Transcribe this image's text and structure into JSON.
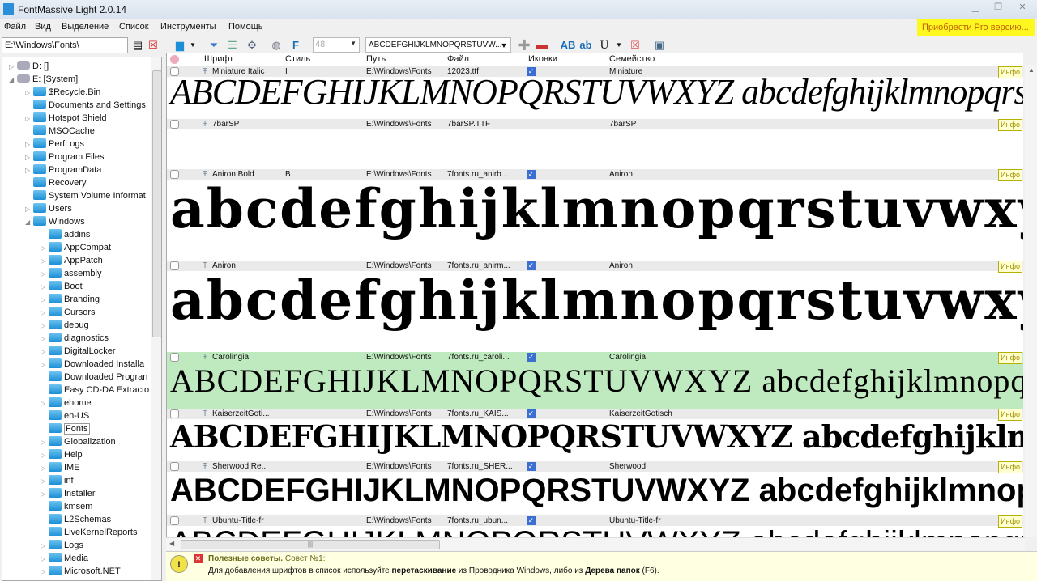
{
  "window": {
    "title": "FontMassive Light 2.0.14"
  },
  "menu": [
    "Файл",
    "Вид",
    "Выделение",
    "Список",
    "Инструменты",
    "Помощь"
  ],
  "pro_button": "Приобрести Pro версию...",
  "path": "E:\\Windows\\Fonts\\",
  "toolbar": {
    "size": "48",
    "sample": "ABCDEFGHIJKLMNOPQRSTUVW...",
    "bold_upper": "AB",
    "bold_lower": "ab",
    "underline": "U"
  },
  "sample_text": "ABCDEFGHIJKLMNOPQRSTUVWXYZ abcdefghijklmnopqrstuvwxyz",
  "columns": {
    "font": "Шрифт",
    "style": "Стиль",
    "path": "Путь",
    "file": "Файл",
    "icons": "Иконки",
    "family": "Семейство"
  },
  "info_label": "Инфо",
  "fonts": [
    {
      "name": "Miniature Italic",
      "style": "I",
      "path": "E:\\Windows\\Fonts",
      "file": "12023.ttf",
      "icons": true,
      "family": "Miniature"
    },
    {
      "name": "7barSP",
      "style": "",
      "path": "E:\\Windows\\Fonts",
      "file": "7barSP.TTF",
      "icons": false,
      "family": "7barSP"
    },
    {
      "name": "Aniron Bold",
      "style": "B",
      "path": "E:\\Windows\\Fonts",
      "file": "7fonts.ru_anirb...",
      "icons": true,
      "family": "Aniron"
    },
    {
      "name": "Aniron",
      "style": "",
      "path": "E:\\Windows\\Fonts",
      "file": "7fonts.ru_anirm...",
      "icons": true,
      "family": "Aniron"
    },
    {
      "name": "Carolingia",
      "style": "",
      "path": "E:\\Windows\\Fonts",
      "file": "7fonts.ru_caroli...",
      "icons": true,
      "family": "Carolingia",
      "highlighted": true
    },
    {
      "name": "KaiserzeitGoti...",
      "style": "",
      "path": "E:\\Windows\\Fonts",
      "file": "7fonts.ru_KAIS...",
      "icons": true,
      "family": "KaiserzeitGotisch"
    },
    {
      "name": "Sherwood Re...",
      "style": "",
      "path": "E:\\Windows\\Fonts",
      "file": "7fonts.ru_SHER...",
      "icons": true,
      "family": "Sherwood"
    },
    {
      "name": "Ubuntu-Title-fr",
      "style": "",
      "path": "E:\\Windows\\Fonts",
      "file": "7fonts.ru_ubun...",
      "icons": true,
      "family": "Ubuntu-Title-fr"
    }
  ],
  "tree": [
    {
      "label": "D: []",
      "level": 0,
      "exp": "collapsed",
      "type": "drive"
    },
    {
      "label": "E: [System]",
      "level": 0,
      "exp": "expanded",
      "type": "drive"
    },
    {
      "label": "$Recycle.Bin",
      "level": 1,
      "exp": "collapsed"
    },
    {
      "label": "Documents and Settings",
      "level": 1,
      "exp": "none"
    },
    {
      "label": "Hotspot Shield",
      "level": 1,
      "exp": "collapsed"
    },
    {
      "label": "MSOCache",
      "level": 1,
      "exp": "none"
    },
    {
      "label": "PerfLogs",
      "level": 1,
      "exp": "collapsed"
    },
    {
      "label": "Program Files",
      "level": 1,
      "exp": "collapsed"
    },
    {
      "label": "ProgramData",
      "level": 1,
      "exp": "collapsed"
    },
    {
      "label": "Recovery",
      "level": 1,
      "exp": "none"
    },
    {
      "label": "System Volume Informat",
      "level": 1,
      "exp": "none"
    },
    {
      "label": "Users",
      "level": 1,
      "exp": "collapsed"
    },
    {
      "label": "Windows",
      "level": 1,
      "exp": "expanded"
    },
    {
      "label": "addins",
      "level": 2,
      "exp": "none"
    },
    {
      "label": "AppCompat",
      "level": 2,
      "exp": "collapsed"
    },
    {
      "label": "AppPatch",
      "level": 2,
      "exp": "collapsed"
    },
    {
      "label": "assembly",
      "level": 2,
      "exp": "collapsed"
    },
    {
      "label": "Boot",
      "level": 2,
      "exp": "collapsed"
    },
    {
      "label": "Branding",
      "level": 2,
      "exp": "collapsed"
    },
    {
      "label": "Cursors",
      "level": 2,
      "exp": "collapsed"
    },
    {
      "label": "debug",
      "level": 2,
      "exp": "collapsed"
    },
    {
      "label": "diagnostics",
      "level": 2,
      "exp": "collapsed"
    },
    {
      "label": "DigitalLocker",
      "level": 2,
      "exp": "collapsed"
    },
    {
      "label": "Downloaded Installa",
      "level": 2,
      "exp": "collapsed"
    },
    {
      "label": "Downloaded Progran",
      "level": 2,
      "exp": "none"
    },
    {
      "label": "Easy CD-DA Extracto",
      "level": 2,
      "exp": "none"
    },
    {
      "label": "ehome",
      "level": 2,
      "exp": "collapsed"
    },
    {
      "label": "en-US",
      "level": 2,
      "exp": "none"
    },
    {
      "label": "Fonts",
      "level": 2,
      "exp": "none",
      "selected": true
    },
    {
      "label": "Globalization",
      "level": 2,
      "exp": "collapsed"
    },
    {
      "label": "Help",
      "level": 2,
      "exp": "collapsed"
    },
    {
      "label": "IME",
      "level": 2,
      "exp": "collapsed"
    },
    {
      "label": "inf",
      "level": 2,
      "exp": "collapsed"
    },
    {
      "label": "Installer",
      "level": 2,
      "exp": "collapsed"
    },
    {
      "label": "kmsem",
      "level": 2,
      "exp": "none"
    },
    {
      "label": "L2Schemas",
      "level": 2,
      "exp": "none"
    },
    {
      "label": "LiveKernelReports",
      "level": 2,
      "exp": "none"
    },
    {
      "label": "Logs",
      "level": 2,
      "exp": "collapsed"
    },
    {
      "label": "Media",
      "level": 2,
      "exp": "collapsed"
    },
    {
      "label": "Microsoft.NET",
      "level": 2,
      "exp": "collapsed"
    }
  ],
  "tips": {
    "title": "Полезные советы.",
    "number": "Совет №1:",
    "text_1": "Для добавления шрифтов в список используйте ",
    "bold_1": "перетаскивание",
    "text_2": " из Проводника Windows, либо из ",
    "bold_2": "Дерева папок",
    "text_3": " (F6)."
  },
  "colors": {
    "highlight_row": "#bfeabf",
    "pro_bg": "#fff820",
    "tips_bg": "#ffffe1"
  }
}
